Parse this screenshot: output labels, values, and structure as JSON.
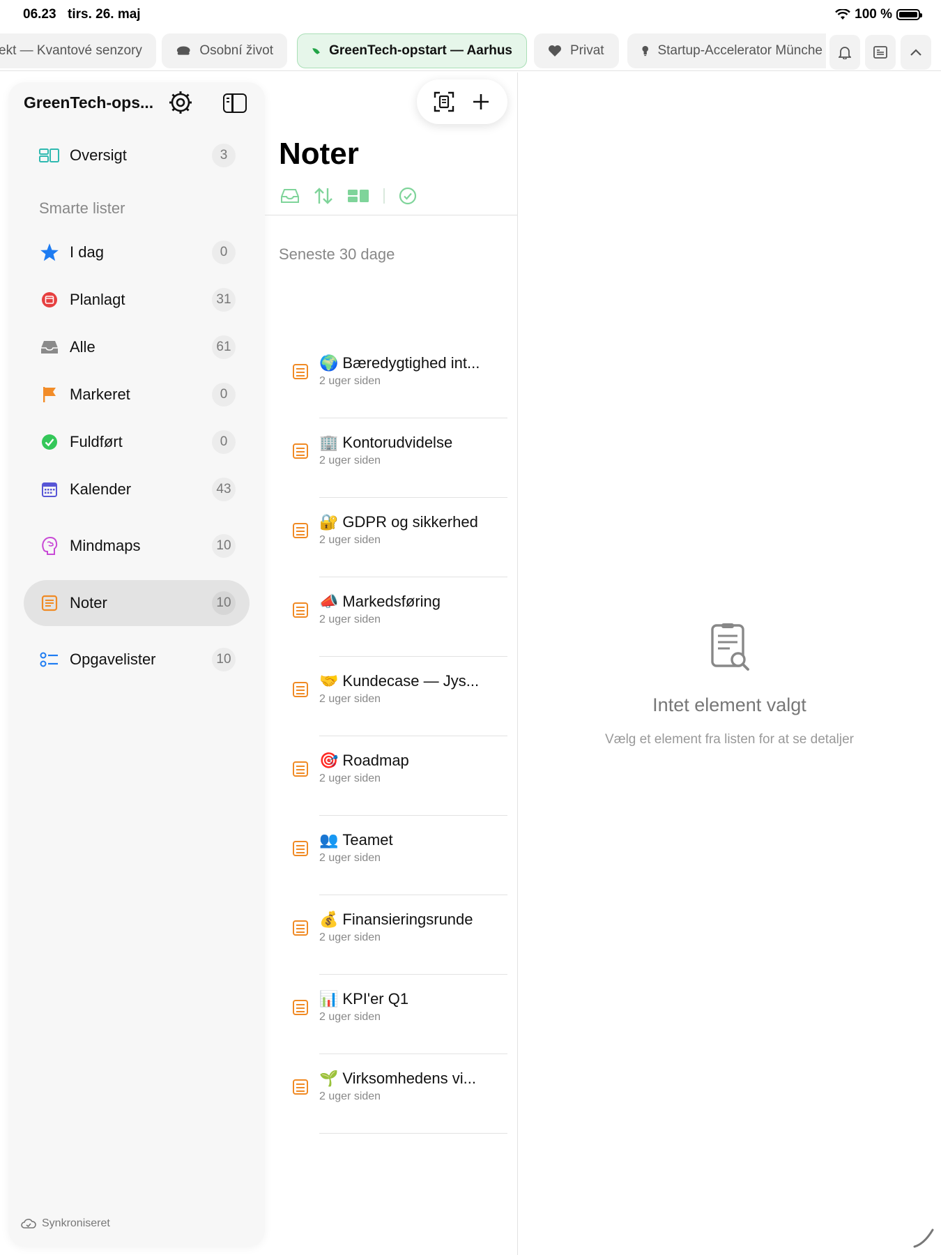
{
  "status": {
    "time": "06.23",
    "date": "tirs. 26. maj",
    "battery": "100 %",
    "battery_level": 1.0
  },
  "tabs": [
    {
      "label": "ekt — Kvantové senzory",
      "icon": "",
      "active": false
    },
    {
      "label": "Osobní život",
      "icon": "cloud-icon",
      "active": false
    },
    {
      "label": "GreenTech-opstart — Aarhus",
      "icon": "leaf-icon",
      "active": true
    },
    {
      "label": "Privat",
      "icon": "heart-icon",
      "active": false
    },
    {
      "label": "Startup-Accelerator Münche",
      "icon": "lightbulb-icon",
      "active": false
    }
  ],
  "sidebar": {
    "title": "GreenTech-ops...",
    "overview": {
      "label": "Oversigt",
      "count": "3"
    },
    "smart_lists_header": "Smarte lister",
    "items": [
      {
        "label": "I dag",
        "count": "0",
        "icon": "star-icon",
        "color": "#1e7cf2"
      },
      {
        "label": "Planlagt",
        "count": "31",
        "icon": "calendar-clock-icon",
        "color": "#e64040"
      },
      {
        "label": "Alle",
        "count": "61",
        "icon": "inbox-icon",
        "color": "#8a8a8a"
      },
      {
        "label": "Markeret",
        "count": "0",
        "icon": "flag-icon",
        "color": "#f28c28"
      },
      {
        "label": "Fuldført",
        "count": "0",
        "icon": "checkmark-circle-icon",
        "color": "#34c759"
      },
      {
        "label": "Kalender",
        "count": "43",
        "icon": "calendar-icon",
        "color": "#5856d6"
      },
      {
        "label": "Mindmaps",
        "count": "10",
        "icon": "brain-icon",
        "color": "#c84ad6"
      },
      {
        "label": "Noter",
        "count": "10",
        "icon": "note-icon",
        "color": "#f08a24",
        "active": true
      },
      {
        "label": "Opgavelister",
        "count": "10",
        "icon": "checklist-icon",
        "color": "#1e7cf2"
      }
    ],
    "sync_status": "Synkroniseret"
  },
  "notes_panel": {
    "title": "Noter",
    "section": "Seneste 30 dage",
    "accent": "#7fd49a",
    "notes": [
      {
        "emoji": "🌍",
        "title": "Bæredygtighed int...",
        "time": "2 uger siden"
      },
      {
        "emoji": "🏢",
        "title": "Kontorudvidelse",
        "time": "2 uger siden"
      },
      {
        "emoji": "🔐",
        "title": "GDPR og sikkerhed",
        "time": "2 uger siden"
      },
      {
        "emoji": "📣",
        "title": "Markedsføring",
        "time": "2 uger siden"
      },
      {
        "emoji": "🤝",
        "title": "Kundecase — Jys...",
        "time": "2 uger siden"
      },
      {
        "emoji": "🎯",
        "title": "Roadmap",
        "time": "2 uger siden"
      },
      {
        "emoji": "👥",
        "title": "Teamet",
        "time": "2 uger siden"
      },
      {
        "emoji": "💰",
        "title": "Finansieringsrunde",
        "time": "2 uger siden"
      },
      {
        "emoji": "📊",
        "title": "KPI'er Q1",
        "time": "2 uger siden"
      },
      {
        "emoji": "🌱",
        "title": "Virksomhedens vi...",
        "time": "2 uger siden"
      }
    ]
  },
  "detail": {
    "empty_title": "Intet element valgt",
    "empty_subtitle": "Vælg et element fra listen for at se detaljer"
  }
}
